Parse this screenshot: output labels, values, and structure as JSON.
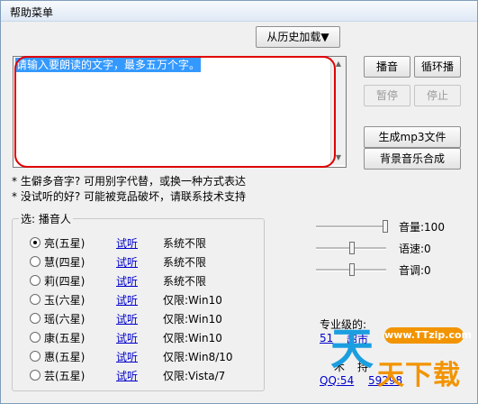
{
  "window": {
    "title": "帮助菜单"
  },
  "history_button": "从历史加载▼",
  "text_input": {
    "placeholder_value": "请输入要朗读的文字，最多五万个字。"
  },
  "buttons": {
    "play": "播音",
    "loop": "循环播",
    "pause": "暂停",
    "stop": "停止",
    "mp3": "生成mp3文件",
    "bgm": "背景音乐合成"
  },
  "notes": [
    "* 生僻多音字? 可用别字代替，或换一种方式表达",
    "* 没试听的好? 可能被竞品破坏，请联系技术支持"
  ],
  "voice_group": {
    "label": "选: 播音人",
    "try_label": "试听",
    "voices": [
      {
        "name": "亮(五星)",
        "system": "系统不限",
        "selected": true
      },
      {
        "name": "慧(四星)",
        "system": "系统不限",
        "selected": false
      },
      {
        "name": "莉(四星)",
        "system": "系统不限",
        "selected": false
      },
      {
        "name": "玉(六星)",
        "system": "仅限:Win10",
        "selected": false
      },
      {
        "name": "瑶(六星)",
        "system": "仅限:Win10",
        "selected": false
      },
      {
        "name": "康(五星)",
        "system": "仅限:Win10",
        "selected": false
      },
      {
        "name": "惠(五星)",
        "system": "仅限:Win8/10",
        "selected": false
      },
      {
        "name": "芸(五星)",
        "system": "仅限:Vista/7",
        "selected": false
      }
    ]
  },
  "sliders": [
    {
      "label": "音量:100",
      "value": 100,
      "min": 0,
      "max": 100
    },
    {
      "label": "语速:0",
      "value": 0,
      "min": -10,
      "max": 10
    },
    {
      "label": "音调:0",
      "value": 0,
      "min": -10,
      "max": 10
    }
  ],
  "promo": {
    "line1": "专业级的:",
    "line2": "51",
    "line2b": "超市",
    "line3": "术",
    "line3b": "持",
    "qq": "QQ:54",
    "qq_tail": "59298"
  },
  "watermark": {
    "site": "www.TTzip.com",
    "big": "天",
    "text": "天下载"
  }
}
